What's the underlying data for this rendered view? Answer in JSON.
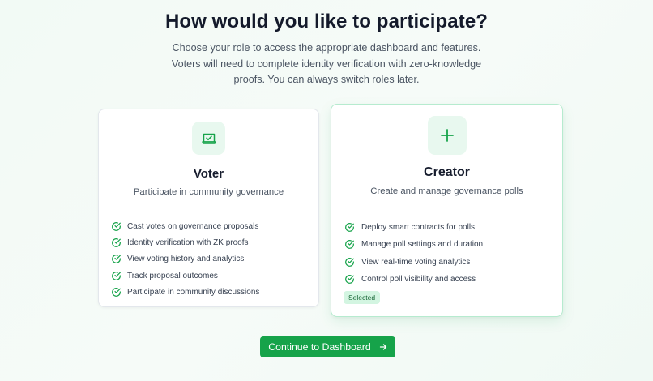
{
  "header": {
    "title": "How would you like to participate?",
    "subtitle": "Choose your role to access the appropriate dashboard and features. Voters will need to complete identity verification with zero-knowledge proofs. You can always switch roles later."
  },
  "roles": [
    {
      "id": "voter",
      "icon": "vote-box-icon",
      "title": "Voter",
      "description": "Participate in community governance",
      "features": [
        "Cast votes on governance proposals",
        "Identity verification with ZK proofs",
        "View voting history and analytics",
        "Track proposal outcomes",
        "Participate in community discussions"
      ],
      "selected": false
    },
    {
      "id": "creator",
      "icon": "plus-icon",
      "title": "Creator",
      "description": "Create and manage governance polls",
      "features": [
        "Deploy smart contracts for polls",
        "Manage poll settings and duration",
        "View real-time voting analytics",
        "Control poll visibility and access"
      ],
      "selected": true,
      "badge": "Selected"
    }
  ],
  "actions": {
    "continue_label": "Continue to Dashboard"
  },
  "colors": {
    "accent": "#16a34a",
    "icon_bg": "#e8f8ef",
    "badge_bg": "#d3f5e1",
    "selected_border": "#b6ebcf"
  }
}
